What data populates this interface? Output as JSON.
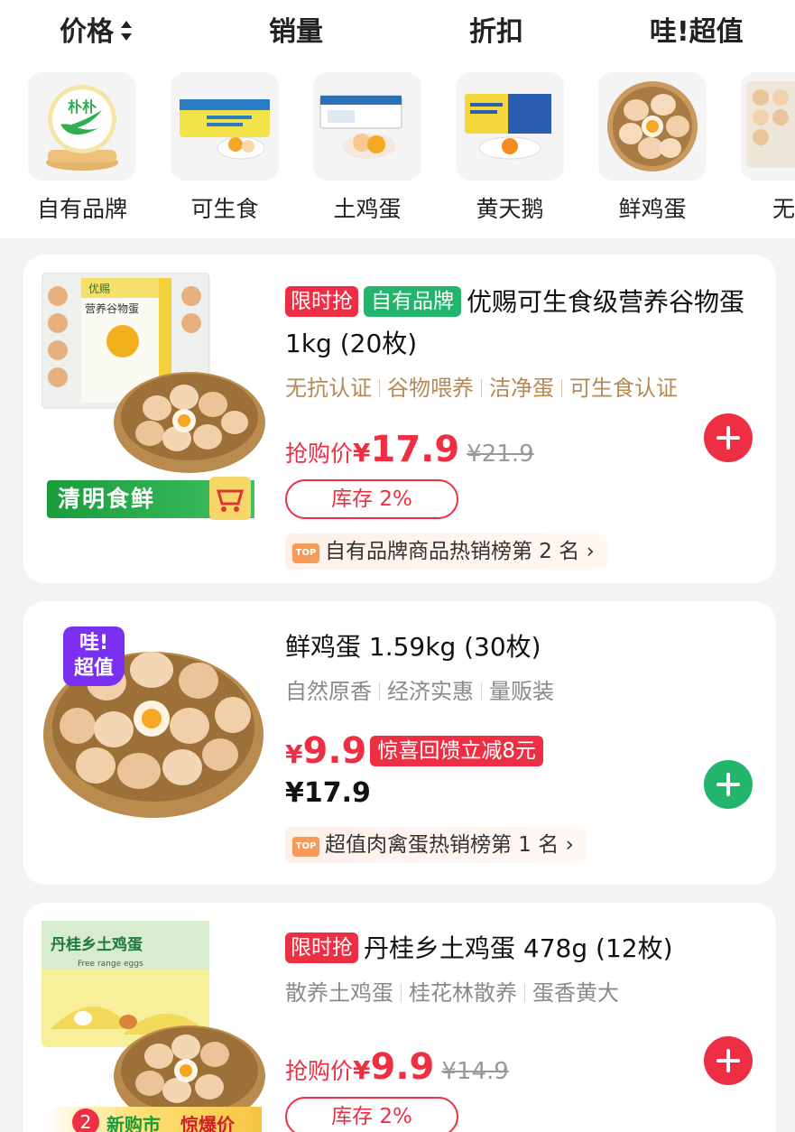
{
  "sort_bar": {
    "price": "价格",
    "sales": "销量",
    "discount": "折扣",
    "value": "哇!超值"
  },
  "categories": [
    {
      "label": "自有品牌",
      "icon": "brand-logo-icon",
      "logo_text": "朴朴"
    },
    {
      "label": "可生食",
      "icon": "egg-box-yellow-icon"
    },
    {
      "label": "土鸡蛋",
      "icon": "egg-box-blue-icon"
    },
    {
      "label": "黄天鹅",
      "icon": "egg-box-huangtiane-icon"
    },
    {
      "label": "鲜鸡蛋",
      "icon": "egg-basket-icon"
    },
    {
      "label": "无抗",
      "icon": "egg-tray-icon"
    }
  ],
  "products": [
    {
      "tags": [
        "限时抢",
        "自有品牌"
      ],
      "title": "优赐可生食级营养谷物蛋 1kg (20枚)",
      "features": [
        "无抗认证",
        "谷物喂养",
        "洁净蛋",
        "可生食认证"
      ],
      "price_label": "抢购价",
      "currency": "¥",
      "price": "17.9",
      "old_price": "¥21.9",
      "stock": "库存 2%",
      "rank": "自有品牌商品热销榜第 2 名",
      "rank_arrow": "›",
      "banner": "清明食鲜",
      "box_brand": "优赐",
      "box_title": "营养谷物蛋",
      "add_color": "#ee2e43"
    },
    {
      "badge_line1": "哇!",
      "badge_line2": "超值",
      "title": "鲜鸡蛋 1.59kg (30枚)",
      "features": [
        "自然原香",
        "经济实惠",
        "量贩装"
      ],
      "currency": "¥",
      "price": "9.9",
      "promo": "惊喜回馈立减8元",
      "old_price": "¥17.9",
      "rank": "超值肉禽蛋热销榜第 1 名",
      "rank_arrow": "›",
      "add_color": "#23b56b"
    },
    {
      "tags": [
        "限时抢"
      ],
      "title": "丹桂乡土鸡蛋 478g (12枚)",
      "features": [
        "散养土鸡蛋",
        "桂花林散养",
        "蛋香黄大"
      ],
      "price_label": "抢购价",
      "currency": "¥",
      "price": "9.9",
      "old_price": "¥14.9",
      "stock": "库存 2%",
      "box_title": "丹桂乡土鸡蛋",
      "box_subtitle": "Free range eggs",
      "bottom_badge_count": "2",
      "bottom_badge_text": "新购市",
      "bottom_badge_text2": "惊爆价",
      "add_color": "#ee2e43"
    }
  ],
  "colors": {
    "accent_red": "#ee2e43",
    "accent_green": "#23b56b",
    "feature_brown": "#b58a58",
    "wow_purple": "#7b2ff0"
  }
}
